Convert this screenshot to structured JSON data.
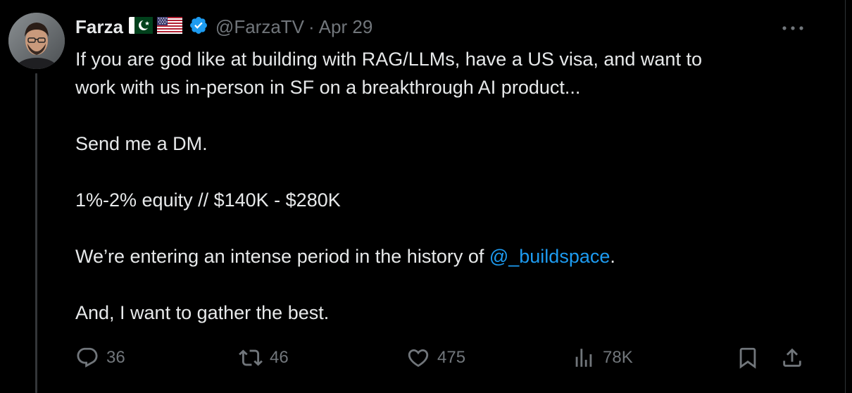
{
  "tweet": {
    "author_name": "Farza",
    "handle": "@FarzaTV",
    "separator": "·",
    "date": "Apr 29",
    "flags": [
      "pakistan-flag",
      "usa-flag"
    ],
    "verified_color": "#1d9bf0",
    "text": {
      "line1": "If you are god like at building with RAG/LLMs, have a US visa, and want to",
      "line2": "work with us in-person in SF on a breakthrough AI product...",
      "line3": "Send me a DM.",
      "line4": "1%-2% equity // $140K - $280K",
      "line5_before": "We’re entering an intense period in the history of ",
      "mention": "@_buildspace",
      "line5_after": ".",
      "line6": "And, I want to gather the best."
    },
    "actions": {
      "replies": "36",
      "retweets": "46",
      "likes": "475",
      "views": "78K"
    }
  },
  "colors": {
    "background": "#000000",
    "text_primary": "#e7e9ea",
    "text_secondary": "#71767b",
    "link": "#1d9bf0",
    "border": "#2f3336"
  },
  "icons": [
    "more-icon",
    "reply-icon",
    "retweet-icon",
    "like-icon",
    "views-icon",
    "bookmark-icon",
    "share-icon",
    "verified-badge-icon"
  ]
}
